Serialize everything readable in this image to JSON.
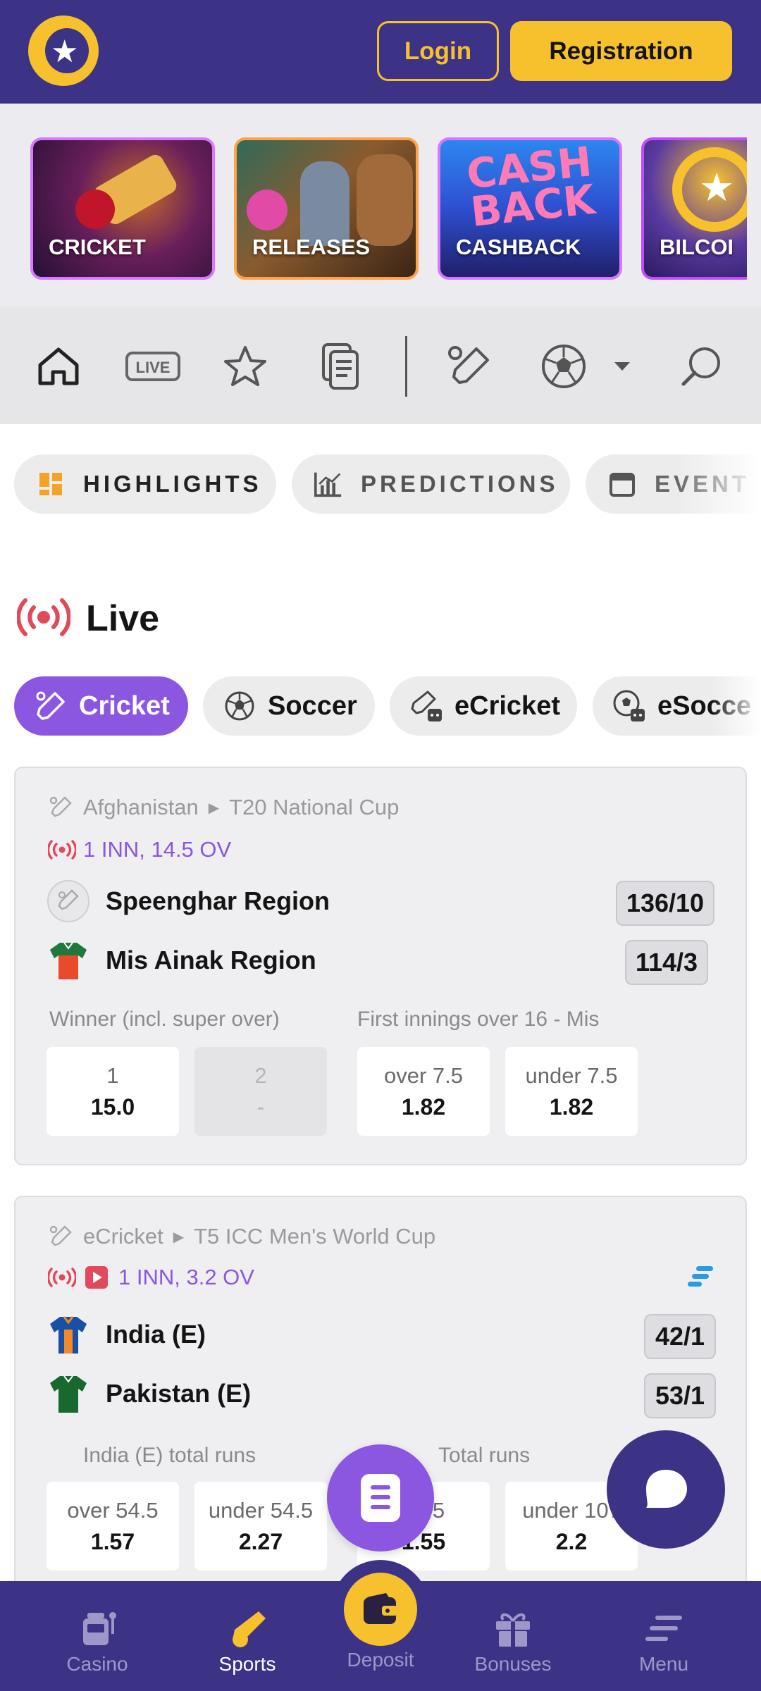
{
  "header": {
    "login_label": "Login",
    "registration_label": "Registration"
  },
  "promos": [
    {
      "label": "CRICKET"
    },
    {
      "label": "RELEASES"
    },
    {
      "label": "CASHBACK"
    },
    {
      "label": "BILCOI"
    }
  ],
  "icon_nav": [
    "home-icon",
    "live-icon",
    "star-icon",
    "betslip-icon",
    "cricket-bat-icon",
    "soccer-ball-icon",
    "caret-down-icon",
    "search-icon"
  ],
  "tabs": [
    {
      "label": "HIGHLIGHTS"
    },
    {
      "label": "PREDICTIONS"
    },
    {
      "label": "EVENT"
    }
  ],
  "live": {
    "title": "Live",
    "sports": [
      {
        "label": "Cricket",
        "active": true
      },
      {
        "label": "Soccer"
      },
      {
        "label": "eCricket"
      },
      {
        "label": "eSocce"
      }
    ]
  },
  "events": [
    {
      "country": "Afghanistan",
      "competition": "T20 National Cup",
      "status": "1 INN, 14.5 OV",
      "team1": {
        "name": "Speenghar Region",
        "score": "136/10"
      },
      "team2": {
        "name": "Mis Ainak Region",
        "score": "114/3"
      },
      "market1": {
        "label": "Winner (incl. super over)",
        "odds": [
          {
            "label": "1",
            "value": "15.0"
          },
          {
            "label": "2",
            "value": "-"
          }
        ]
      },
      "market2": {
        "label": "First innings over 16 - Mis",
        "odds": [
          {
            "label": "over 7.5",
            "value": "1.82"
          },
          {
            "label": "under 7.5",
            "value": "1.82"
          }
        ]
      }
    },
    {
      "country": "eCricket",
      "competition": "T5 ICC Men's World Cup",
      "status": "1 INN, 3.2 OV",
      "team1": {
        "name": "India (E)",
        "score": "42/1"
      },
      "team2": {
        "name": "Pakistan (E)",
        "score": "53/1"
      },
      "market1": {
        "label": "India (E) total runs",
        "odds": [
          {
            "label": "over 54.5",
            "value": "1.57"
          },
          {
            "label": "under 54.5",
            "value": "2.27"
          }
        ]
      },
      "market2": {
        "label": "Total runs",
        "odds": [
          {
            "label": "07.5",
            "value": "1.55"
          },
          {
            "label": "under 107",
            "value": "2.2"
          }
        ]
      }
    }
  ],
  "bottom_nav": [
    {
      "label": "Casino"
    },
    {
      "label": "Sports",
      "active": true
    },
    {
      "label": "Deposit"
    },
    {
      "label": "Bonuses"
    },
    {
      "label": "Menu"
    }
  ],
  "colors": {
    "brand": "#3d3386",
    "accent": "#f7c02d",
    "live_purple": "#8b56e0",
    "live_red": "#e04a5a"
  }
}
